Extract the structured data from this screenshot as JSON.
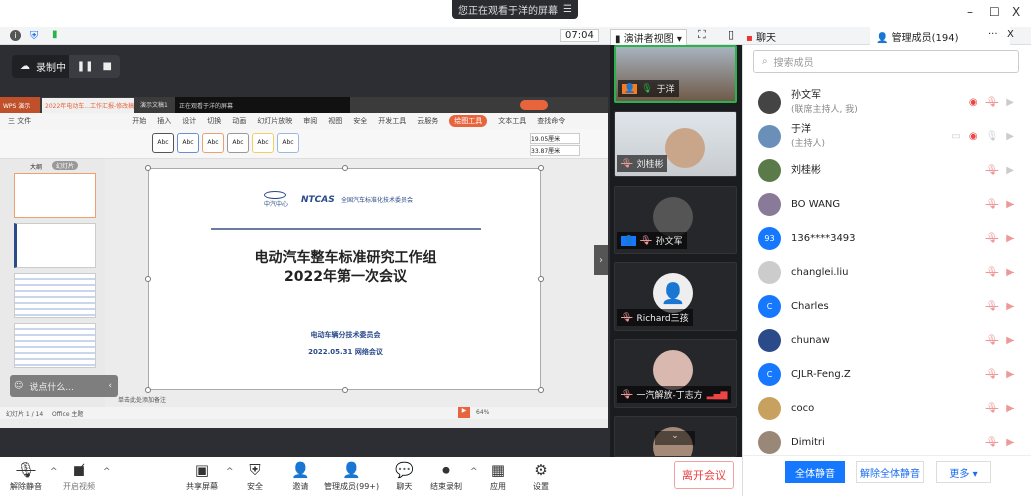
{
  "top": {
    "viewing_banner": "您正在观看于洋的屏幕",
    "banner_menu_icon": "menu-icon",
    "minimize": "–",
    "maximize": "☐",
    "close": "X"
  },
  "bar": {
    "timer": "07:04",
    "view_mode": "演讲者视图"
  },
  "tabs": {
    "chat": "聊天",
    "members": "管理成员(194)",
    "more": "···",
    "close": "X"
  },
  "recording": {
    "label": "录制中"
  },
  "wps": {
    "app_tab": "WPS 演示",
    "doc_tab": "2022年电动车...工作汇报-修改稿",
    "tab2": "演示文稿1",
    "notice": "正在观看于洋的屏幕",
    "menu": [
      "三 文件",
      "开始",
      "插入",
      "设计",
      "切换",
      "动画",
      "幻灯片放映",
      "审阅",
      "视图",
      "安全",
      "开发工具",
      "云服务",
      "绘图工具",
      "文本工具",
      "查找命令"
    ],
    "shape_styles": [
      "Abc",
      "Abc",
      "Abc",
      "Abc",
      "Abc",
      "Abc"
    ],
    "height": "19.05厘米",
    "width": "33.87厘米",
    "panel_tabs": [
      "大纲",
      "幻灯片"
    ],
    "status": "幻灯片 1 / 14",
    "theme": "Office 主题",
    "zoom": "64%",
    "notes": "单击此处添加备注",
    "comment_placeholder": "说点什么..."
  },
  "slide": {
    "org_short": "中汽中心",
    "logo": "NTCAS",
    "org_full": "全国汽车标准化技术委员会",
    "title1": "电动汽车整车标准研究工作组",
    "title2": "2022年第一次会议",
    "committee": "电动车辆分技术委员会",
    "date": "2022.05.31 网络会议"
  },
  "videos": [
    {
      "name": "于洋"
    },
    {
      "name": "刘桂彬"
    },
    {
      "name": "孙文军"
    },
    {
      "name": "Richard三孩"
    },
    {
      "name": "一汽解放-丁志方"
    }
  ],
  "search": {
    "placeholder": "搜索成员"
  },
  "members": [
    {
      "name": "孙文军",
      "role": "(联席主持人, 我)",
      "avatar": "",
      "color": "#444"
    },
    {
      "name": "于洋",
      "role": "(主持人)",
      "avatar": "",
      "color": "#6a8fb8"
    },
    {
      "name": "刘桂彬",
      "role": "",
      "avatar": "",
      "color": "#5a7a4a"
    },
    {
      "name": "BO WANG",
      "role": "",
      "avatar": "",
      "color": "#8a7a9a"
    },
    {
      "name": "136****3493",
      "role": "",
      "avatar": "93",
      "color": "#1677ff"
    },
    {
      "name": "changlei.liu",
      "role": "",
      "avatar": "",
      "color": "#ccc"
    },
    {
      "name": "Charles",
      "role": "",
      "avatar": "C",
      "color": "#1677ff"
    },
    {
      "name": "chunaw",
      "role": "",
      "avatar": "",
      "color": "#2a4a8a"
    },
    {
      "name": "CJLR-Feng.Z",
      "role": "",
      "avatar": "C",
      "color": "#1677ff"
    },
    {
      "name": "coco",
      "role": "",
      "avatar": "",
      "color": "#c8a060"
    },
    {
      "name": "Dimitri",
      "role": "",
      "avatar": "",
      "color": "#998877"
    }
  ],
  "panel_footer": {
    "mute_all": "全体静音",
    "unmute_all": "解除全体静音",
    "more": "更多 ▾"
  },
  "toolbar": {
    "unmute": "解除静音",
    "video": "开启视频",
    "share": "共享屏幕",
    "security": "安全",
    "invite": "邀请",
    "members": "管理成员(99+)",
    "chat": "聊天",
    "stop_rec": "结束录制",
    "apps": "应用",
    "settings": "设置",
    "leave": "离开会议"
  },
  "colors": {
    "accent": "#1677ff",
    "leave": "#e84040",
    "wps_orange": "#e8643c"
  }
}
